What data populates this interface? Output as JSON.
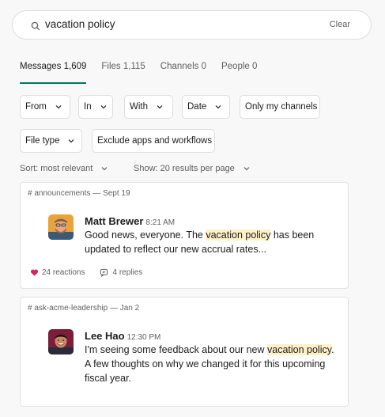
{
  "search": {
    "query": "vacation policy",
    "clear_label": "Clear"
  },
  "tabs": [
    {
      "label": "Messages 1,609",
      "active": true
    },
    {
      "label": "Files 1,115",
      "active": false
    },
    {
      "label": "Channels 0",
      "active": false
    },
    {
      "label": "People 0",
      "active": false
    }
  ],
  "filters": {
    "from": "From",
    "in": "In",
    "with": "With",
    "date": "Date",
    "only_my_channels": "Only my channels",
    "file_type": "File type",
    "exclude_apps": "Exclude apps and workflows"
  },
  "sort": {
    "sort_label": "Sort: most relevant",
    "show_label": "Show: 20 results per page"
  },
  "results": [
    {
      "channel": "# announcements",
      "date": "— Sept 19",
      "author": "Matt Brewer",
      "time": "8:21 AM",
      "msg_before": "Good news, everyone. The ",
      "msg_highlight": "vacation policy",
      "msg_after": " has been updated to reflect our new accrual rates...",
      "reactions_label": "24 reactions",
      "replies_label": "4 replies"
    },
    {
      "channel": "# ask-acme-leadership",
      "date": "— Jan 2",
      "author": "Lee Hao",
      "time": "12:30 PM",
      "msg_before": "I'm seeing some feedback about our new ",
      "msg_highlight": "vacation policy",
      "msg_after": ". A few thoughts on why we changed it for this upcoming fiscal year."
    }
  ],
  "colors": {
    "tab_underline": "#007a5a",
    "highlight": "#fdf1c8",
    "heart": "#e01e5a"
  },
  "icons": [
    "search-icon",
    "chevron-down-icon",
    "heart-icon",
    "replies-icon"
  ]
}
